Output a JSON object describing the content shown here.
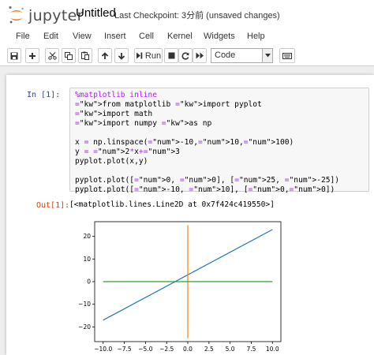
{
  "header": {
    "logo_text": "jupyter",
    "notebook_title": "Untitled",
    "checkpoint": "Last Checkpoint: 3分前   (unsaved changes)"
  },
  "menu": [
    "File",
    "Edit",
    "View",
    "Insert",
    "Cell",
    "Kernel",
    "Widgets",
    "Help"
  ],
  "toolbar": {
    "run_label": "Run",
    "cell_type": "Code",
    "icons": [
      "save-icon",
      "plus-icon",
      "cut-icon",
      "copy-icon",
      "paste-icon",
      "arrow-up-icon",
      "arrow-down-icon",
      "step-forward-icon",
      "stop-icon",
      "restart-icon",
      "fast-forward-icon",
      "keyboard-icon"
    ]
  },
  "cell": {
    "in_prompt": "In [1]:",
    "out_prompt": "Out[1]:",
    "output_text": "[<matplotlib.lines.Line2D at 0x7f424c419550>]",
    "code_lines": [
      "%matplotlib inline",
      "from matplotlib import pyplot",
      "import math",
      "import numpy as np",
      "",
      "x = np.linspace(-10,10,100)",
      "y = 2*x+3",
      "pyplot.plot(x,y)",
      "",
      "pyplot.plot([0, 0], [25, -25])",
      "pyplot.plot([-10, 10], [0,0])"
    ]
  },
  "chart_data": {
    "type": "line",
    "xlim": [
      -11,
      11
    ],
    "ylim": [
      -26.5,
      26.5
    ],
    "xticks": [
      "−10.0",
      "−7.5",
      "−5.0",
      "−2.5",
      "0.0",
      "2.5",
      "5.0",
      "7.5",
      "10.0"
    ],
    "xtick_values": [
      -10,
      -7.5,
      -5,
      -2.5,
      0,
      2.5,
      5,
      7.5,
      10
    ],
    "yticks": [
      "20",
      "10",
      "0",
      "−10",
      "−20"
    ],
    "ytick_values": [
      20,
      10,
      0,
      -10,
      -20
    ],
    "series": [
      {
        "x": [
          -10,
          10
        ],
        "y": [
          -17,
          23
        ],
        "color": "#1f77b4"
      },
      {
        "x": [
          0,
          0
        ],
        "y": [
          25,
          -25
        ],
        "color": "#ff7f0e"
      },
      {
        "x": [
          -10,
          10
        ],
        "y": [
          0,
          0
        ],
        "color": "#2ca02c"
      }
    ]
  }
}
